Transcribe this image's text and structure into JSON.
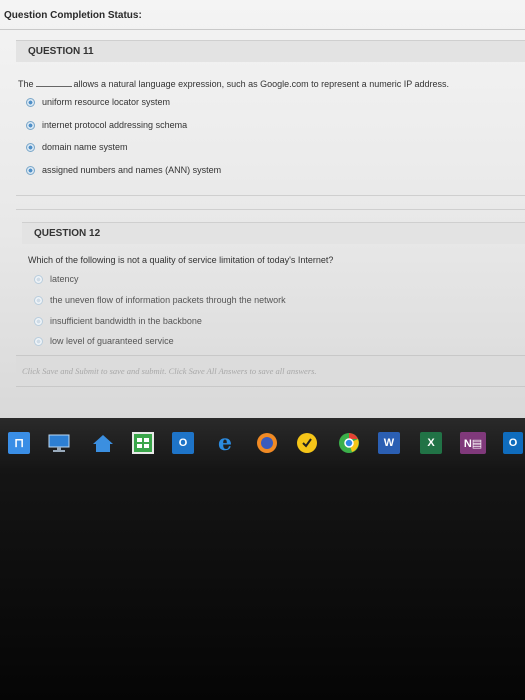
{
  "page": {
    "status_label": "Question Completion Status:"
  },
  "questions": [
    {
      "header": "QUESTION 11",
      "prefix": "The",
      "text": "allows a natural language expression, such as Google.com to represent a numeric IP address.",
      "options": [
        "uniform resource locator system",
        "internet protocol addressing schema",
        "domain name system",
        "assigned numbers and names (ANN) system"
      ]
    },
    {
      "header": "QUESTION 12",
      "text": "Which of the following is not a quality of service limitation of today's Internet?",
      "options": [
        "latency",
        "the uneven flow of information packets through the network",
        "insufficient bandwidth in the backbone",
        "low level of guaranteed service"
      ]
    }
  ],
  "footer": {
    "save_instruction": "Click Save and Submit to save and submit. Click Save All Answers to save all answers."
  },
  "taskbar": {
    "icons": [
      {
        "name": "start-icon",
        "glyph": "⊓",
        "color": "#3a8ee6"
      },
      {
        "name": "desktop-icon",
        "glyph": "",
        "color": "#2d7fd3"
      },
      {
        "name": "home-icon",
        "glyph": "⌂",
        "color": "#3b8fe0"
      },
      {
        "name": "store-icon",
        "glyph": "▦",
        "color": "#3aa54a"
      },
      {
        "name": "outlook-icon",
        "glyph": "O",
        "color": "#1e74c8"
      },
      {
        "name": "edge-icon",
        "glyph": "e",
        "color": "#2b8be0"
      },
      {
        "name": "firefox-icon",
        "glyph": "◉",
        "color": "#f08a24"
      },
      {
        "name": "norton-icon",
        "glyph": "●",
        "color": "#f5c518"
      },
      {
        "name": "chrome-icon",
        "glyph": "◍",
        "color": "#3bb04a"
      },
      {
        "name": "word-icon",
        "glyph": "W",
        "color": "#2b5fb3"
      },
      {
        "name": "excel-icon",
        "glyph": "X",
        "color": "#217346"
      },
      {
        "name": "onenote-icon",
        "glyph": "N",
        "color": "#80397b"
      },
      {
        "name": "outlook2-icon",
        "glyph": "O",
        "color": "#0f6cbd"
      }
    ]
  }
}
